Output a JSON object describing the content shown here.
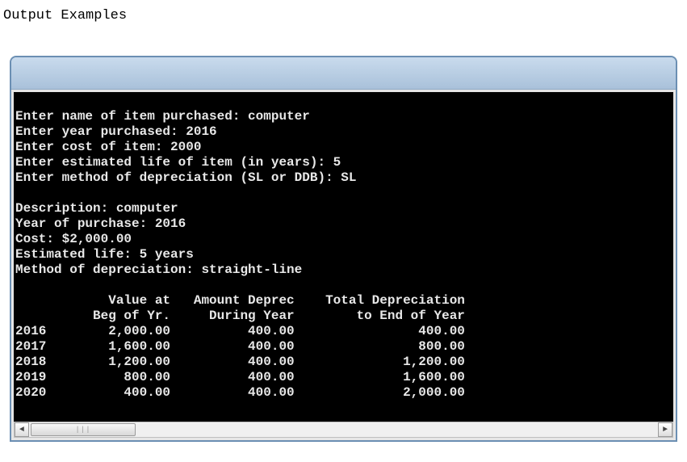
{
  "page_title": "Output Examples",
  "prompts": {
    "name": {
      "label": "Enter name of item purchased: ",
      "value": "computer"
    },
    "year": {
      "label": "Enter year purchased: ",
      "value": "2016"
    },
    "cost": {
      "label": "Enter cost of item: ",
      "value": "2000"
    },
    "life": {
      "label": "Enter estimated life of item (in years): ",
      "value": "5"
    },
    "method": {
      "label": "Enter method of depreciation (SL or DDB): ",
      "value": "SL"
    }
  },
  "summary": {
    "description": {
      "label": "Description: ",
      "value": "computer"
    },
    "year": {
      "label": "Year of purchase: ",
      "value": "2016"
    },
    "cost": {
      "label": "Cost: ",
      "value": "$2,000.00"
    },
    "life": {
      "label": "Estimated life: ",
      "value": "5 years"
    },
    "method": {
      "label": "Method of depreciation: ",
      "value": "straight-line"
    }
  },
  "table": {
    "header1": {
      "c0": "",
      "c1": "Value at",
      "c2": "Amount Deprec",
      "c3": "Total Depreciation"
    },
    "header2": {
      "c0": "",
      "c1": "Beg of Yr.",
      "c2": "During Year",
      "c3": "to End of Year"
    },
    "rows": [
      {
        "year": "2016",
        "beg": "2,000.00",
        "dep": "400.00",
        "tot": "400.00"
      },
      {
        "year": "2017",
        "beg": "1,600.00",
        "dep": "400.00",
        "tot": "800.00"
      },
      {
        "year": "2018",
        "beg": "1,200.00",
        "dep": "400.00",
        "tot": "1,200.00"
      },
      {
        "year": "2019",
        "beg": "800.00",
        "dep": "400.00",
        "tot": "1,600.00"
      },
      {
        "year": "2020",
        "beg": "400.00",
        "dep": "400.00",
        "tot": "2,000.00"
      }
    ]
  },
  "scrollbar": {
    "left_glyph": "◄",
    "right_glyph": "►",
    "thumb_glyph": "|||"
  }
}
